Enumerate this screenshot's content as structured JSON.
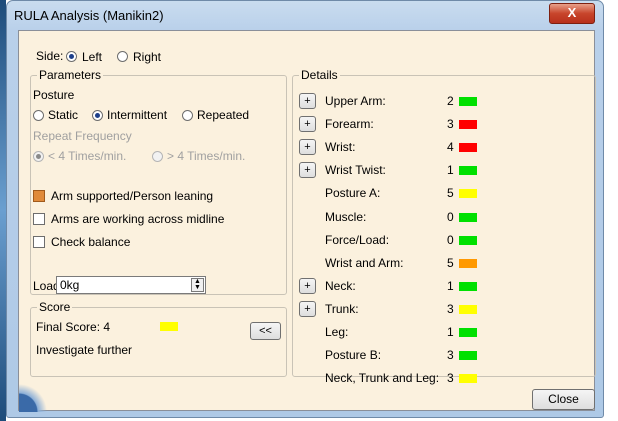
{
  "window": {
    "title": "RULA Analysis (Manikin2)",
    "close_glyph": "X"
  },
  "side": {
    "label": "Side:",
    "options": [
      "Left",
      "Right"
    ],
    "selected": "Left"
  },
  "parameters": {
    "legend": "Parameters",
    "posture_label": "Posture",
    "posture_options": [
      "Static",
      "Intermittent",
      "Repeated"
    ],
    "posture_selected": "Intermittent",
    "repeat_label": "Repeat Frequency",
    "repeat_options": [
      "< 4 Times/min.",
      "> 4 Times/min."
    ],
    "repeat_selected": "< 4 Times/min.",
    "checkboxes": [
      {
        "label": "Arm supported/Person leaning",
        "checked": true
      },
      {
        "label": "Arms are working across midline",
        "checked": false
      },
      {
        "label": "Check balance",
        "checked": false
      }
    ],
    "load_label": "Load:",
    "load_value": "0kg"
  },
  "score": {
    "legend": "Score",
    "final_score": "Final Score: 4",
    "final_color": "#ffff00",
    "verdict": "Investigate further",
    "toggle_label": "<<"
  },
  "details": {
    "legend": "Details",
    "expand_label": "+",
    "rows": [
      {
        "name": "Upper Arm:",
        "value": "2",
        "color": "#00e000",
        "expandable": true
      },
      {
        "name": "Forearm:",
        "value": "3",
        "color": "#ff0000",
        "expandable": true
      },
      {
        "name": "Wrist:",
        "value": "4",
        "color": "#ff0000",
        "expandable": true
      },
      {
        "name": "Wrist Twist:",
        "value": "1",
        "color": "#00e000",
        "expandable": true
      },
      {
        "name": "Posture A:",
        "value": "5",
        "color": "#ffff00",
        "expandable": false
      },
      {
        "name": "Muscle:",
        "value": "0",
        "color": "#00e000",
        "expandable": false
      },
      {
        "name": "Force/Load:",
        "value": "0",
        "color": "#00e000",
        "expandable": false
      },
      {
        "name": "Wrist and Arm:",
        "value": "5",
        "color": "#ff9900",
        "expandable": false
      },
      {
        "name": "Neck:",
        "value": "1",
        "color": "#00e000",
        "expandable": true
      },
      {
        "name": "Trunk:",
        "value": "3",
        "color": "#ffff00",
        "expandable": true
      },
      {
        "name": "Leg:",
        "value": "1",
        "color": "#00e000",
        "expandable": false
      },
      {
        "name": "Posture B:",
        "value": "3",
        "color": "#00e000",
        "expandable": false
      },
      {
        "name": "Neck, Trunk and Leg:",
        "value": "3",
        "color": "#ffff00",
        "expandable": false
      }
    ]
  },
  "footer": {
    "close_label": "Close"
  }
}
